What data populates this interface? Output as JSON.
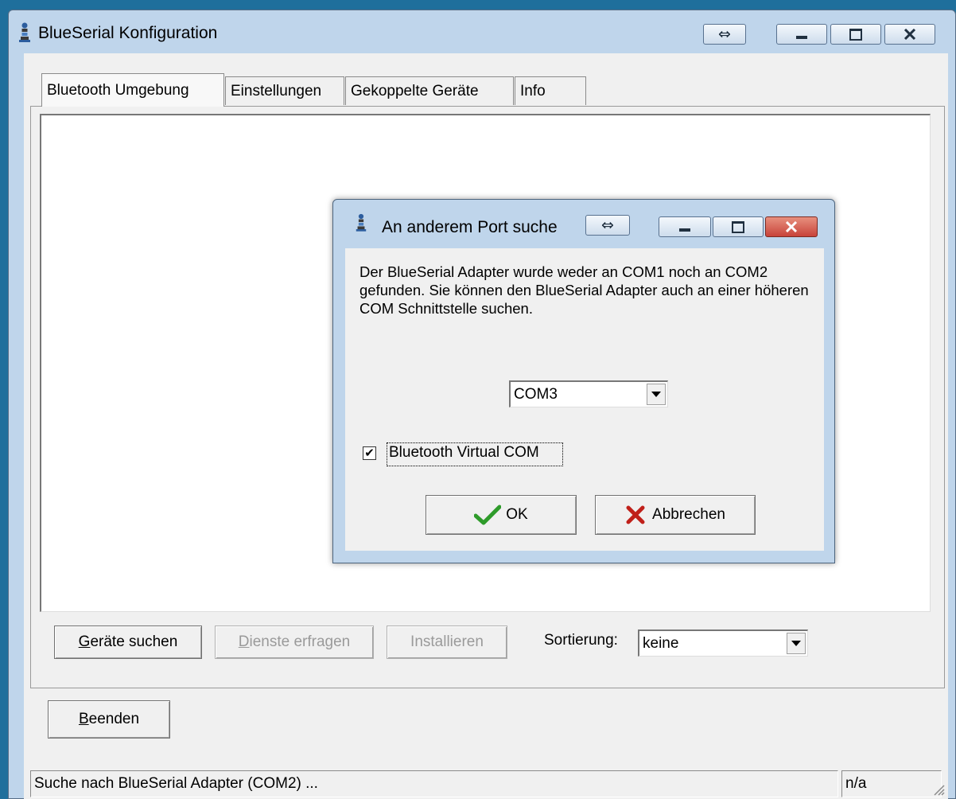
{
  "main_window": {
    "title": "BlueSerial Konfiguration",
    "swap_glyph": "⇔",
    "tabs": [
      "Bluetooth Umgebung",
      "Einstellungen",
      "Gekoppelte Geräte",
      "Info"
    ],
    "buttons": {
      "search_devices_u": "G",
      "search_devices_rest": "eräte suchen",
      "query_services_u": "D",
      "query_services_rest": "ienste erfragen",
      "install": "Installieren",
      "exit_u": "B",
      "exit_rest": "eenden"
    },
    "sort_label": "Sortierung:",
    "sort_value": "keine",
    "status_text": "Suche nach BlueSerial Adapter (COM2) ...",
    "status_right": "n/a"
  },
  "dialog": {
    "title": "An anderem Port suche",
    "swap_glyph": "⇔",
    "message": "Der BlueSerial Adapter wurde weder an COM1 noch an COM2 gefunden. Sie können den BlueSerial Adapter auch an einer höheren COM Schnittstelle suchen.",
    "port_value": "COM3",
    "checkbox_label": "Bluetooth Virtual COM",
    "checkbox_checked": true,
    "checkmark": "✔",
    "ok_label": "OK",
    "cancel_label": "Abbrechen"
  },
  "colors": {
    "desktop": "#1f6f9c",
    "frame": "#bfd5eb",
    "close_button": "#c8433a",
    "ok_icon": "#2e9b2a",
    "cancel_icon": "#c0201a"
  },
  "icons": [
    "bluetooth-tower-icon",
    "snap-arrows-icon",
    "minimize-icon",
    "maximize-icon",
    "close-icon",
    "checkmark-icon",
    "cross-icon",
    "dropdown-arrow-icon",
    "resize-grip-icon"
  ]
}
